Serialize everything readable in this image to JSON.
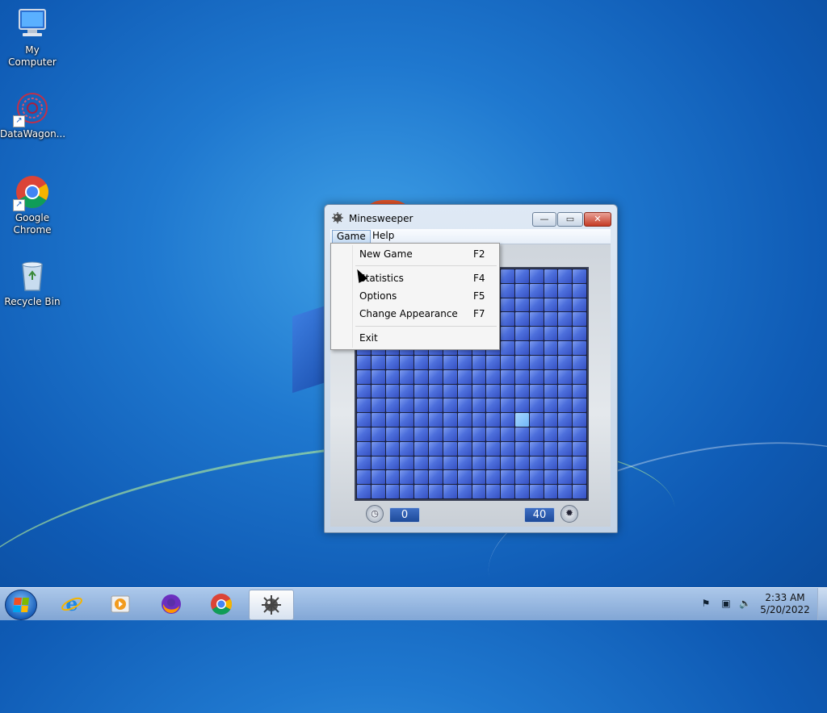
{
  "desktop": {
    "icons": [
      {
        "label": "My Computer",
        "icon": "computer-icon"
      },
      {
        "label": "DataWagon...",
        "icon": "datawagon-icon"
      },
      {
        "label": "Google Chrome",
        "icon": "chrome-icon"
      },
      {
        "label": "Recycle Bin",
        "icon": "recycle-bin-icon"
      }
    ]
  },
  "window": {
    "title": "Minesweeper",
    "controls": {
      "minimize": "—",
      "maximize": "▭",
      "close": "✕"
    },
    "menu": {
      "game": "Game",
      "help": "Help"
    },
    "game_menu_items": [
      {
        "label": "New Game",
        "shortcut": "F2"
      },
      {
        "label": "Statistics",
        "shortcut": "F4"
      },
      {
        "label": "Options",
        "shortcut": "F5"
      },
      {
        "label": "Change Appearance",
        "shortcut": "F7"
      },
      {
        "label": "Exit",
        "shortcut": ""
      }
    ],
    "board": {
      "rows": 16,
      "cols": 16,
      "highlighted_cell": {
        "row": 10,
        "col": 11
      }
    },
    "timer_value": "0",
    "mines_value": "40"
  },
  "taskbar": {
    "pinned": [
      "start-button",
      "internet-explorer-icon",
      "media-player-icon",
      "firefox-icon",
      "chrome-icon",
      "minesweeper-icon"
    ],
    "active": "minesweeper-icon",
    "clock_time": "2:33 AM",
    "clock_date": "5/20/2022"
  }
}
